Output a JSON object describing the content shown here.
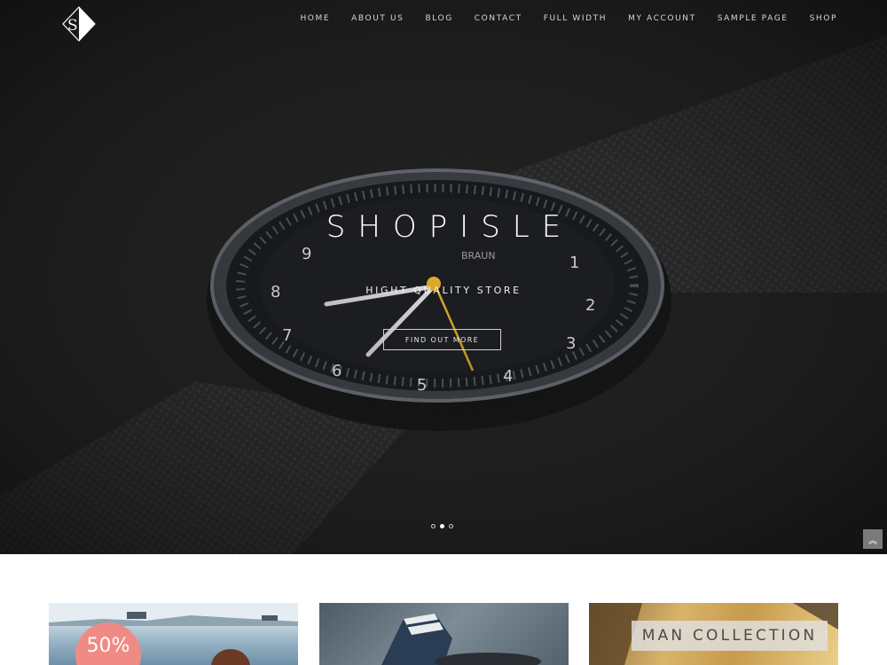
{
  "nav": {
    "items": [
      {
        "label": "HOME"
      },
      {
        "label": "ABOUT US"
      },
      {
        "label": "BLOG"
      },
      {
        "label": "CONTACT"
      },
      {
        "label": "FULL WIDTH"
      },
      {
        "label": "MY ACCOUNT"
      },
      {
        "label": "SAMPLE PAGE"
      },
      {
        "label": "SHOP"
      }
    ]
  },
  "hero": {
    "title": "SHOPISLE",
    "subtitle": "HIGHT QUALITY STORE",
    "button_label": "FIND OUT MORE",
    "active_slide": 2,
    "slide_count": 3
  },
  "watch": {
    "numbers": [
      "9",
      "8",
      "7",
      "6",
      "5",
      "4",
      "3",
      "2",
      "1"
    ],
    "brand": "BRAUN"
  },
  "cards": [
    {
      "badge": "50%"
    },
    {},
    {
      "label": "MAN COLLECTION"
    }
  ],
  "colors": {
    "hero_bg": "#1b1b1c",
    "badge": "#f08a85",
    "second_hand": "#e0a92a"
  }
}
